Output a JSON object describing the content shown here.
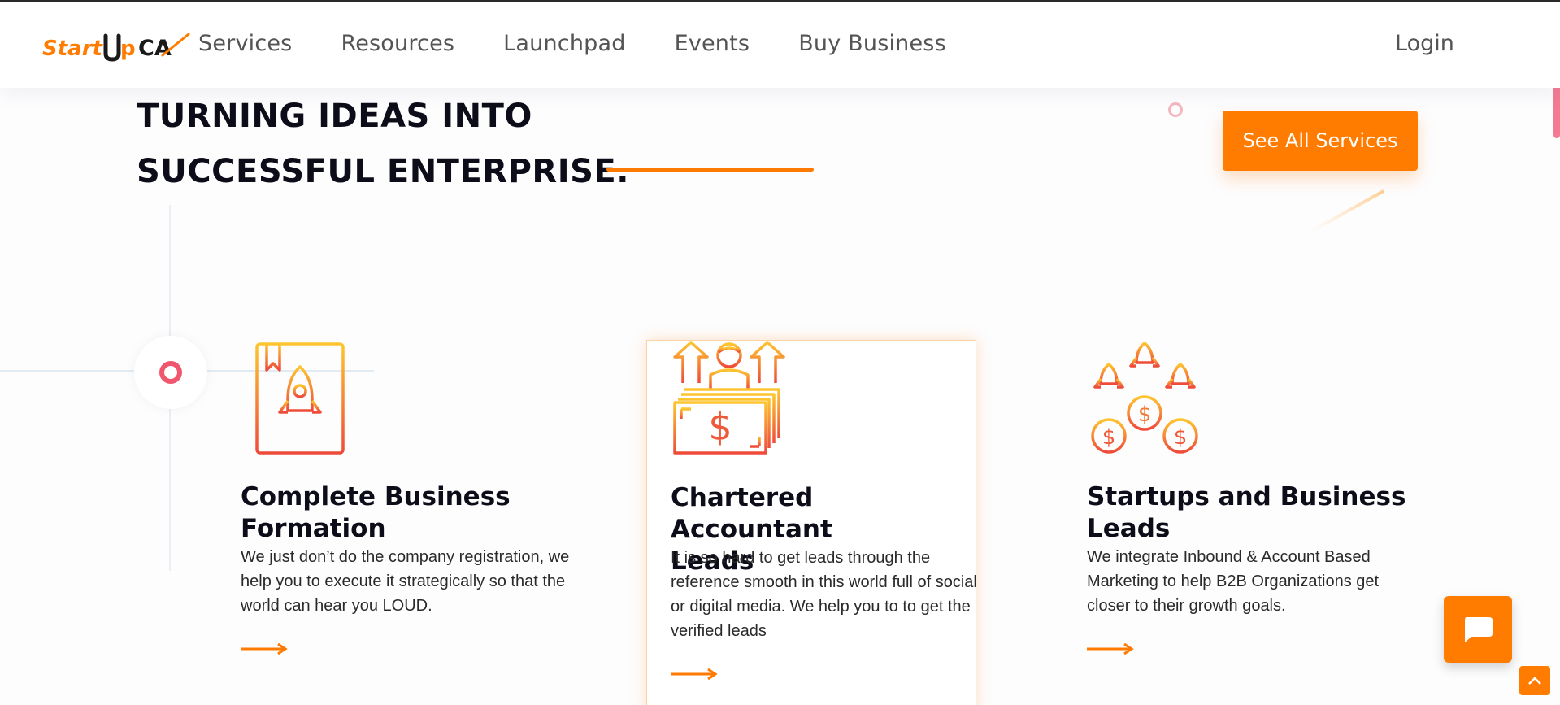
{
  "header": {
    "logo_text": "StartUpCA",
    "nav": [
      "Services",
      "Resources",
      "Launchpad",
      "Events",
      "Buy Business"
    ],
    "login_label": "Login"
  },
  "hero": {
    "line1": "TURNING IDEAS INTO",
    "line2": "SUCCESSFUL ENTERPRISE.",
    "cta_label": "See All Services"
  },
  "cards": [
    {
      "title_line1": "Complete Business",
      "title_line2": "Formation",
      "text": "We just don’t do the company registration, we help you to execute it strategically so that the world can hear you LOUD.",
      "icon": "rocket-certificate-icon"
    },
    {
      "title_line1": "Chartered Accountant",
      "title_line2": "Leads",
      "text": "It is so hard to get leads through the reference smooth in this world full of social or digital media. We help you to to get the verified leads",
      "icon": "money-leads-icon"
    },
    {
      "title_line1": "Startups and Business",
      "title_line2": "Leads",
      "text": "We integrate Inbound & Account Based Marketing to help B2B Organizations get closer to their growth goals.",
      "icon": "rockets-coins-icon"
    }
  ],
  "colors": {
    "accent": "#ff7c00",
    "heading": "#0d0d1a",
    "nav_text": "#545454",
    "pink": "#f0566e"
  }
}
